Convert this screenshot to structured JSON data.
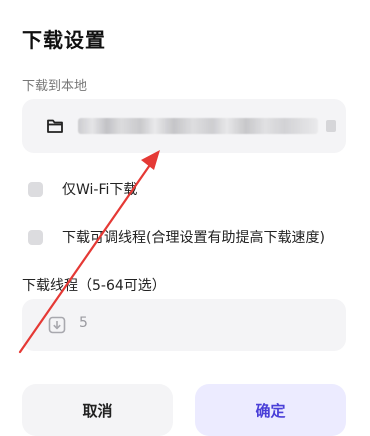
{
  "dialog": {
    "title": "下载设置",
    "download_location_label": "下载到本地",
    "wifi_only_label": "仅Wi-Fi下载",
    "adjustable_threads_label": "下载可调线程(合理设置有助提高下载速度)",
    "threads_label": "下载线程（5-64可选）",
    "threads_value": "5",
    "cancel_label": "取消",
    "confirm_label": "确定"
  },
  "colors": {
    "confirm_text": "#4a3fd8",
    "confirm_bg": "#ecebff",
    "annotation_arrow": "#e53935"
  },
  "icons": {
    "folder": "folder-icon",
    "download": "download-icon"
  }
}
